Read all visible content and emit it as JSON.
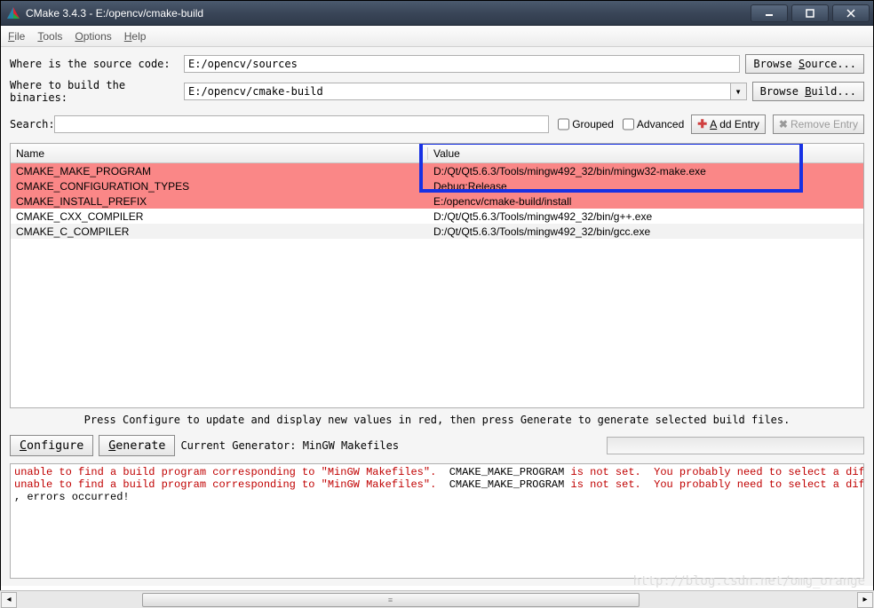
{
  "window": {
    "title": "CMake 3.4.3 - E:/opencv/cmake-build"
  },
  "menu": {
    "file": "File",
    "tools": "Tools",
    "options": "Options",
    "help": "Help"
  },
  "paths": {
    "source_label": "Where is the source code:",
    "source_value": "E:/opencv/sources",
    "browse_source": "Browse Source...",
    "build_label": "Where to build the binaries:",
    "build_value": "E:/opencv/cmake-build",
    "browse_build": "Browse Build..."
  },
  "search": {
    "label": "Search:",
    "value": "",
    "grouped": "Grouped",
    "advanced": "Advanced",
    "add_entry": "Add Entry",
    "remove_entry": "Remove Entry"
  },
  "table": {
    "col_name": "Name",
    "col_value": "Value",
    "rows": [
      {
        "name": "CMAKE_MAKE_PROGRAM",
        "value": "D:/Qt/Qt5.6.3/Tools/mingw492_32/bin/mingw32-make.exe",
        "red": true
      },
      {
        "name": "CMAKE_CONFIGURATION_TYPES",
        "value": "Debug;Release",
        "red": true
      },
      {
        "name": "CMAKE_INSTALL_PREFIX",
        "value": "E:/opencv/cmake-build/install",
        "red": true
      },
      {
        "name": "CMAKE_CXX_COMPILER",
        "value": "D:/Qt/Qt5.6.3/Tools/mingw492_32/bin/g++.exe",
        "red": false
      },
      {
        "name": "CMAKE_C_COMPILER",
        "value": "D:/Qt/Qt5.6.3/Tools/mingw492_32/bin/gcc.exe",
        "red": false
      }
    ]
  },
  "hint": "Press Configure to update and display new values in red, then press Generate to generate selected build files.",
  "actions": {
    "configure": "Configure",
    "generate": "Generate",
    "generator_label": "Current Generator: MinGW Makefiles"
  },
  "log": {
    "line1a": "unable to find a build program corresponding to \"MinGW Makefiles\".  ",
    "line1b": "CMAKE_MAKE_PROGRAM",
    "line1c": " is not set.  You probably need to select a diffe",
    "line2a": "unable to find a build program corresponding to \"MinGW Makefiles\".  ",
    "line2b": "CMAKE_MAKE_PROGRAM",
    "line2c": " is not set.  You probably need to select a diffe",
    "line3": ", errors occurred!"
  },
  "watermark": "http://blog.csdn.net/omg_orange"
}
